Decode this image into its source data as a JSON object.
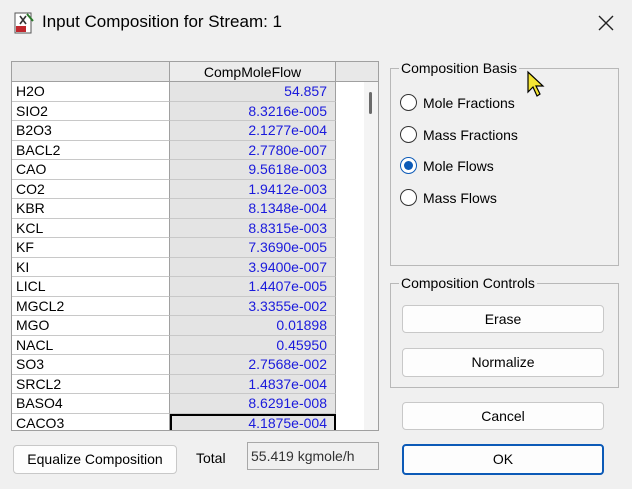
{
  "window": {
    "title": "Input Composition for Stream: 1"
  },
  "grid": {
    "column_header": "CompMoleFlow",
    "rows": [
      {
        "name": "H2O",
        "value": "54.857"
      },
      {
        "name": "SIO2",
        "value": "8.3216e-005"
      },
      {
        "name": "B2O3",
        "value": "2.1277e-004"
      },
      {
        "name": "BACL2",
        "value": "2.7780e-007"
      },
      {
        "name": "CAO",
        "value": "9.5618e-003"
      },
      {
        "name": "CO2",
        "value": "1.9412e-003"
      },
      {
        "name": "KBR",
        "value": "8.1348e-004"
      },
      {
        "name": "KCL",
        "value": "8.8315e-003"
      },
      {
        "name": "KF",
        "value": "7.3690e-005"
      },
      {
        "name": "KI",
        "value": "3.9400e-007"
      },
      {
        "name": "LICL",
        "value": "1.4407e-005"
      },
      {
        "name": "MGCL2",
        "value": "3.3355e-002"
      },
      {
        "name": "MGO",
        "value": "0.01898"
      },
      {
        "name": "NACL",
        "value": "0.45950"
      },
      {
        "name": "SO3",
        "value": "2.7568e-002"
      },
      {
        "name": "SRCL2",
        "value": "1.4837e-004"
      },
      {
        "name": "BASO4",
        "value": "8.6291e-008"
      },
      {
        "name": "CACO3",
        "value": "4.1875e-004"
      }
    ]
  },
  "composition_basis": {
    "label": "Composition Basis",
    "options": [
      "Mole Fractions",
      "Mass Fractions",
      "Mole Flows",
      "Mass Flows"
    ],
    "selected": "Mole Flows"
  },
  "composition_controls": {
    "label": "Composition Controls",
    "erase_label": "Erase",
    "normalize_label": "Normalize"
  },
  "buttons": {
    "cancel_label": "Cancel",
    "ok_label": "OK",
    "equalize_label": "Equalize Composition"
  },
  "total": {
    "label": "Total",
    "value": "55.419 kgmole/h"
  },
  "colors": {
    "value_text": "#1a1adc",
    "accent": "#0c5ab7"
  }
}
